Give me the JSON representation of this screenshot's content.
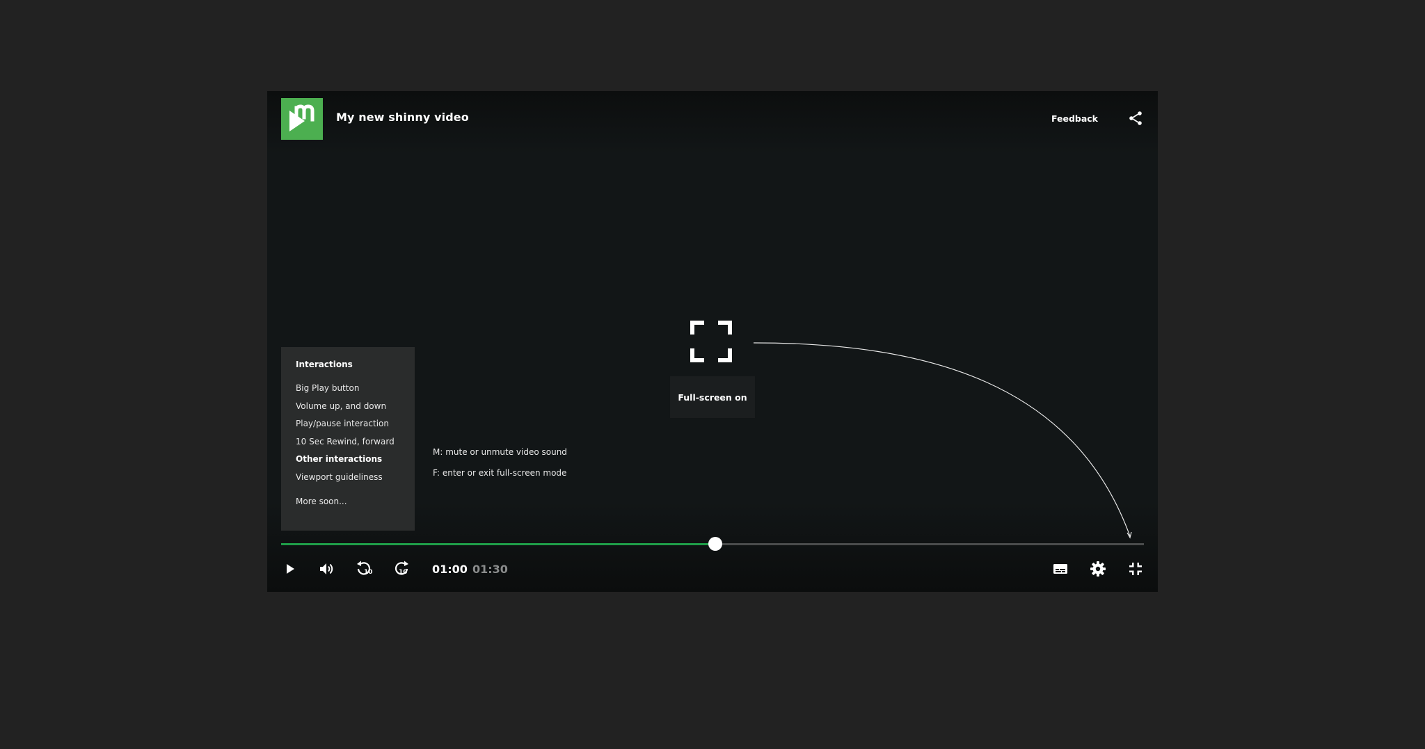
{
  "header": {
    "title": "My new shinny video",
    "feedback_label": "Feedback"
  },
  "overlay": {
    "fullscreen_tooltip": "Full-screen on"
  },
  "panel": {
    "heading": "Interactions",
    "items": [
      "Big Play button",
      "Volume up, and down",
      "Play/pause interaction",
      "10 Sec Rewind, forward",
      "Other interactions",
      "Viewport guideliness"
    ],
    "more": "More soon..."
  },
  "shortcuts": [
    "M: mute or unmute video sound",
    "F: enter or exit full-screen mode"
  ],
  "player": {
    "progress_percent": 50.3,
    "time_current": "01:00",
    "time_total": "01:30",
    "rewind_seconds": "10",
    "forward_seconds": "10"
  },
  "colors": {
    "brand": "#4caf50",
    "progress": "#1f9e49",
    "background": "#121617"
  },
  "icons": {
    "logo": "m-play-logo-icon",
    "share": "share-icon",
    "play": "play-icon",
    "volume": "volume-icon",
    "rewind": "rewind-10-icon",
    "forward": "forward-10-icon",
    "subtitles": "subtitles-icon",
    "settings": "gear-icon",
    "exit_fullscreen": "exit-fullscreen-icon",
    "fullscreen": "fullscreen-icon"
  }
}
